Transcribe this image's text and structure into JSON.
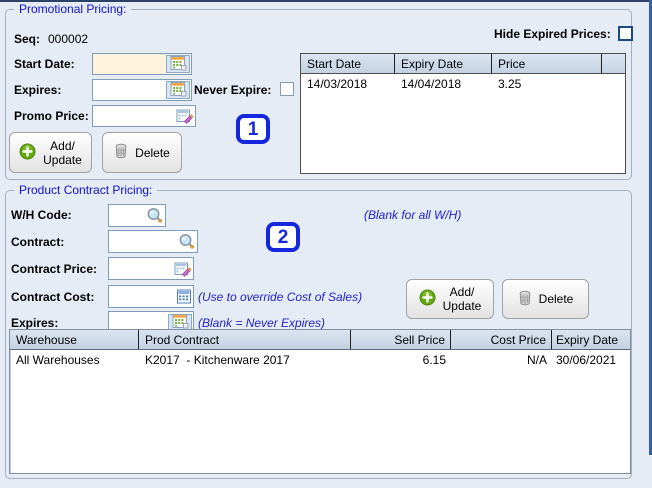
{
  "promo": {
    "title": "Promotional Pricing:",
    "seq": {
      "label": "Seq:",
      "value": "000002"
    },
    "start_date": {
      "label": "Start Date:",
      "value": ""
    },
    "expires": {
      "label": "Expires:",
      "value": ""
    },
    "never_expire": {
      "label": "Never Expire:",
      "checked": false
    },
    "promo_price": {
      "label": "Promo Price:",
      "value": ""
    },
    "add_update": {
      "line1": "Add/",
      "line2": "Update"
    },
    "delete_label": "Delete",
    "marker": "1",
    "hide_expired": {
      "label": "Hide Expired Prices:",
      "checked": false
    },
    "table": {
      "columns": [
        "Start Date",
        "Expiry Date",
        "Price"
      ],
      "rows": [
        [
          "14/03/2018",
          "14/04/2018",
          "3.25"
        ]
      ]
    }
  },
  "contract": {
    "title": "Product Contract Pricing:",
    "wh_code": {
      "label": "W/H Code:",
      "value": "",
      "hint": "(Blank for all W/H)"
    },
    "contract": {
      "label": "Contract:",
      "value": ""
    },
    "contract_price": {
      "label": "Contract Price:",
      "value": ""
    },
    "contract_cost": {
      "label": "Contract Cost:",
      "value": "",
      "hint": "(Use to override Cost of Sales)"
    },
    "expires": {
      "label": "Expires:",
      "value": "",
      "hint": "(Blank = Never Expires)"
    },
    "add_update": {
      "line1": "Add/",
      "line2": "Update"
    },
    "delete_label": "Delete",
    "marker": "2",
    "table": {
      "columns": [
        "Warehouse",
        "Prod Contract",
        "Sell Price",
        "Cost Price",
        "Expiry Date"
      ],
      "rows": [
        [
          "All Warehouses",
          "K2017  - Kitchenware 2017",
          "6.15",
          "N/A",
          "30/06/2021"
        ]
      ]
    }
  },
  "colors": {
    "background": "#e5ecf6",
    "group_title_blue": "#1111cc",
    "hint_blue": "#2323cd",
    "marker_blue": "#1427dd",
    "field_border": "#7f9db9",
    "start_date_field_cream": "#fdf3dd",
    "table_header_top": "#dbe5f0",
    "table_header_bottom": "#c3d2e2",
    "window_right_border": "#3a5fa8"
  }
}
